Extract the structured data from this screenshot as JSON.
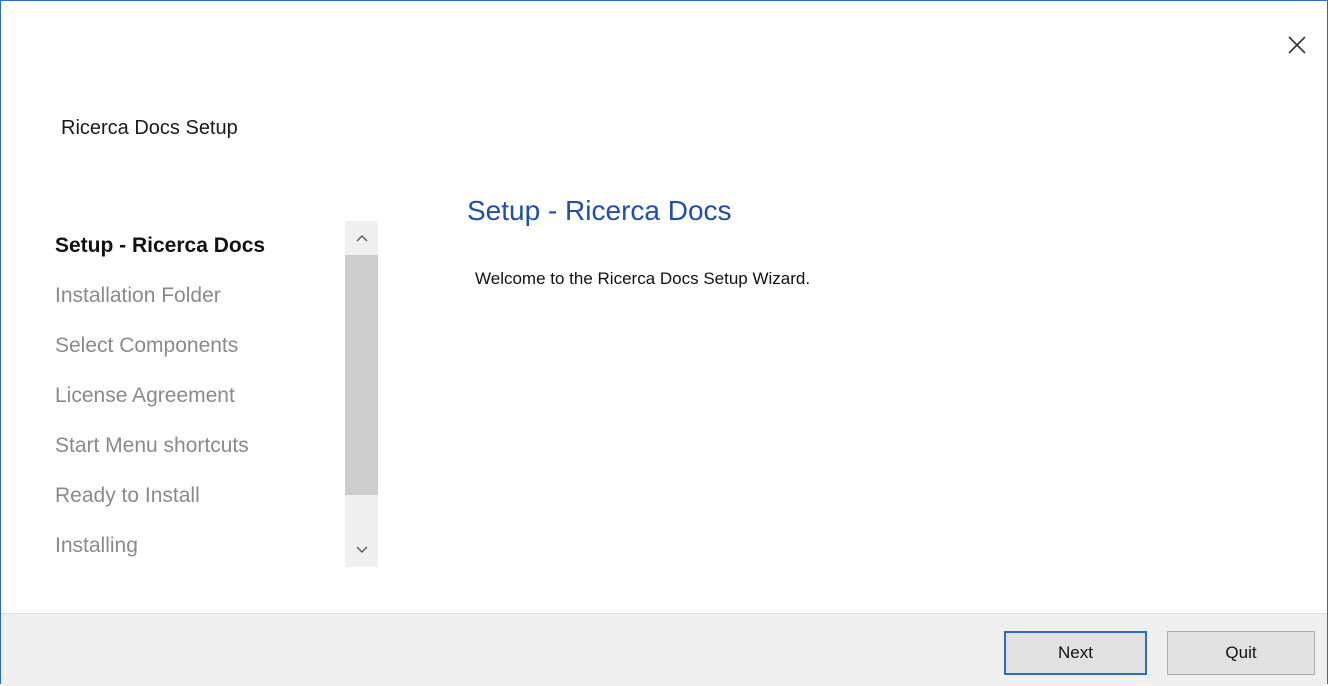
{
  "window": {
    "app_title": "Ricerca Docs Setup",
    "close_icon": "close-icon"
  },
  "sidebar": {
    "items": [
      {
        "label": "Setup - Ricerca Docs",
        "active": true
      },
      {
        "label": "Installation Folder",
        "active": false
      },
      {
        "label": "Select Components",
        "active": false
      },
      {
        "label": "License Agreement",
        "active": false
      },
      {
        "label": "Start Menu shortcuts",
        "active": false
      },
      {
        "label": "Ready to Install",
        "active": false
      },
      {
        "label": "Installing",
        "active": false
      }
    ],
    "scroll_up_icon": "chevron-up-icon",
    "scroll_down_icon": "chevron-down-icon"
  },
  "main": {
    "heading": "Setup - Ricerca Docs",
    "welcome_text": "Welcome to the Ricerca Docs Setup Wizard."
  },
  "footer": {
    "next_label": "Next",
    "quit_label": "Quit"
  },
  "colors": {
    "accent": "#2b6cc4",
    "heading": "#1f4fa8",
    "inactive_step": "#8a8a8a",
    "footer_bg": "#f0f0f0"
  }
}
